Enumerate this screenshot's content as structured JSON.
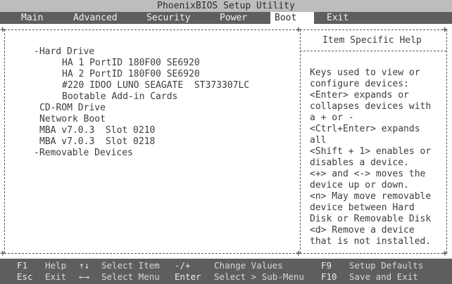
{
  "window": {
    "title": "PhoenixBIOS Setup Utility"
  },
  "menu": {
    "items": [
      "Main",
      "Advanced",
      "Security",
      "Power",
      "Boot",
      "Exit"
    ],
    "active": "Boot"
  },
  "boot": {
    "hard_drive": "-Hard Drive",
    "hd_items": [
      "HA 1 PortID 180F00 SE6920",
      "HA 2 PortID 180F00 SE6920",
      "#220 IDOO LUNO SEAGATE  ST373307LC",
      "Bootable Add-in Cards"
    ],
    "cdrom": "CD-ROM Drive",
    "network": "Network Boot",
    "mba1": "MBA v7.0.3  Slot 0210",
    "mba2": "MBA v7.0.3  Slot 0218",
    "removable": "-Removable Devices"
  },
  "help": {
    "title": "Item Specific Help",
    "lines": [
      "Keys used to view or",
      "configure devices:",
      "<Enter> expands or",
      "collapses devices with",
      "a + or -",
      "<Ctrl+Enter> expands",
      "all",
      "<Shift + 1> enables or",
      "disables a device.",
      "<+> and <-> moves the",
      "device up or down.",
      "<n> May move removable",
      "device between Hard",
      "Disk or Removable Disk",
      "<d> Remove a device",
      "that is not installed."
    ]
  },
  "footer": {
    "row1": [
      {
        "key": "F1",
        "desc": "Help"
      },
      {
        "key": "↑↓",
        "desc": "Select Item"
      },
      {
        "key": "-/+",
        "desc": "Change Values"
      },
      {
        "key": "F9",
        "desc": "Setup Defaults"
      }
    ],
    "row2": [
      {
        "key": "Esc",
        "desc": "Exit"
      },
      {
        "key": "←→",
        "desc": "Select Menu"
      },
      {
        "key": "Enter",
        "desc": "Select > Sub-Menu"
      },
      {
        "key": "F10",
        "desc": "Save and Exit"
      }
    ]
  }
}
